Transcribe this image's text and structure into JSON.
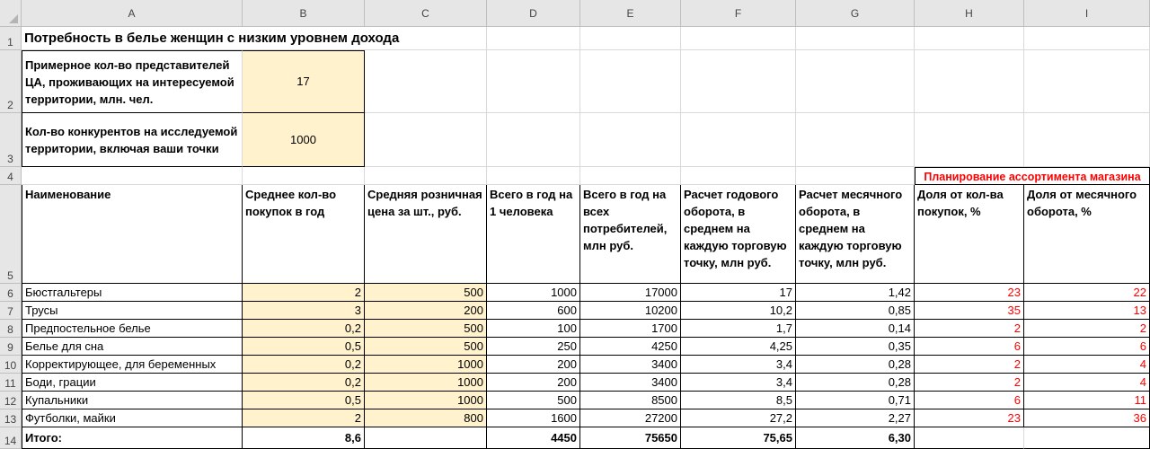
{
  "columns": [
    "A",
    "B",
    "C",
    "D",
    "E",
    "F",
    "G",
    "H",
    "I"
  ],
  "row_numbers": [
    "1",
    "2",
    "3",
    "4",
    "5",
    "6",
    "7",
    "8",
    "9",
    "10",
    "11",
    "12",
    "13",
    "14"
  ],
  "title": "Потребность в белье женщин с низким уровнем дохода",
  "params": [
    {
      "label": "Примерное кол-во представителей ЦА, проживающих на интересуемой территории, млн. чел.",
      "value": "17"
    },
    {
      "label": "Кол-во конкурентов на исследуемой территории, включая ваши точки",
      "value": "1000"
    }
  ],
  "planning_header": "Планирование ассортимента магазина",
  "headers": [
    "Наименование",
    "Среднее кол-во покупок в год",
    "Средняя розничная цена за шт., руб.",
    "Всего в год на 1 человека",
    "Всего в год на всех потребителей, млн руб.",
    "Расчет годового оборота, в среднем на каждую торговую точку, млн руб.",
    "Расчет месячного оборота, в среднем на каждую торговую точку, млн руб.",
    "Доля от кол-ва покупок, %",
    "Доля от месячного оборота, %"
  ],
  "rows": [
    {
      "name": "Бюстгальтеры",
      "purchases": "2",
      "price": "500",
      "per_person": "1000",
      "total": "17000",
      "annual": "17",
      "monthly": "1,42",
      "share_qty": "23",
      "share_turnover": "22"
    },
    {
      "name": "Трусы",
      "purchases": "3",
      "price": "200",
      "per_person": "600",
      "total": "10200",
      "annual": "10,2",
      "monthly": "0,85",
      "share_qty": "35",
      "share_turnover": "13"
    },
    {
      "name": "Предпостельное белье",
      "purchases": "0,2",
      "price": "500",
      "per_person": "100",
      "total": "1700",
      "annual": "1,7",
      "monthly": "0,14",
      "share_qty": "2",
      "share_turnover": "2"
    },
    {
      "name": "Белье для сна",
      "purchases": "0,5",
      "price": "500",
      "per_person": "250",
      "total": "4250",
      "annual": "4,25",
      "monthly": "0,35",
      "share_qty": "6",
      "share_turnover": "6"
    },
    {
      "name": "Корректирующее, для беременных",
      "purchases": "0,2",
      "price": "1000",
      "per_person": "200",
      "total": "3400",
      "annual": "3,4",
      "monthly": "0,28",
      "share_qty": "2",
      "share_turnover": "4"
    },
    {
      "name": "Боди, грации",
      "purchases": "0,2",
      "price": "1000",
      "per_person": "200",
      "total": "3400",
      "annual": "3,4",
      "monthly": "0,28",
      "share_qty": "2",
      "share_turnover": "4"
    },
    {
      "name": "Купальники",
      "purchases": "0,5",
      "price": "1000",
      "per_person": "500",
      "total": "8500",
      "annual": "8,5",
      "monthly": "0,71",
      "share_qty": "6",
      "share_turnover": "11"
    },
    {
      "name": "Футболки, майки",
      "purchases": "2",
      "price": "800",
      "per_person": "1600",
      "total": "27200",
      "annual": "27,2",
      "monthly": "2,27",
      "share_qty": "23",
      "share_turnover": "36"
    }
  ],
  "total_row": {
    "label": "Итого:",
    "purchases": "8,6",
    "per_person": "4450",
    "total": "75650",
    "annual": "75,65",
    "monthly": "6,30"
  },
  "colors": {
    "highlight": "#fff2cc",
    "accent_red": "#ff0000",
    "header_bg": "#e6e6e6"
  }
}
